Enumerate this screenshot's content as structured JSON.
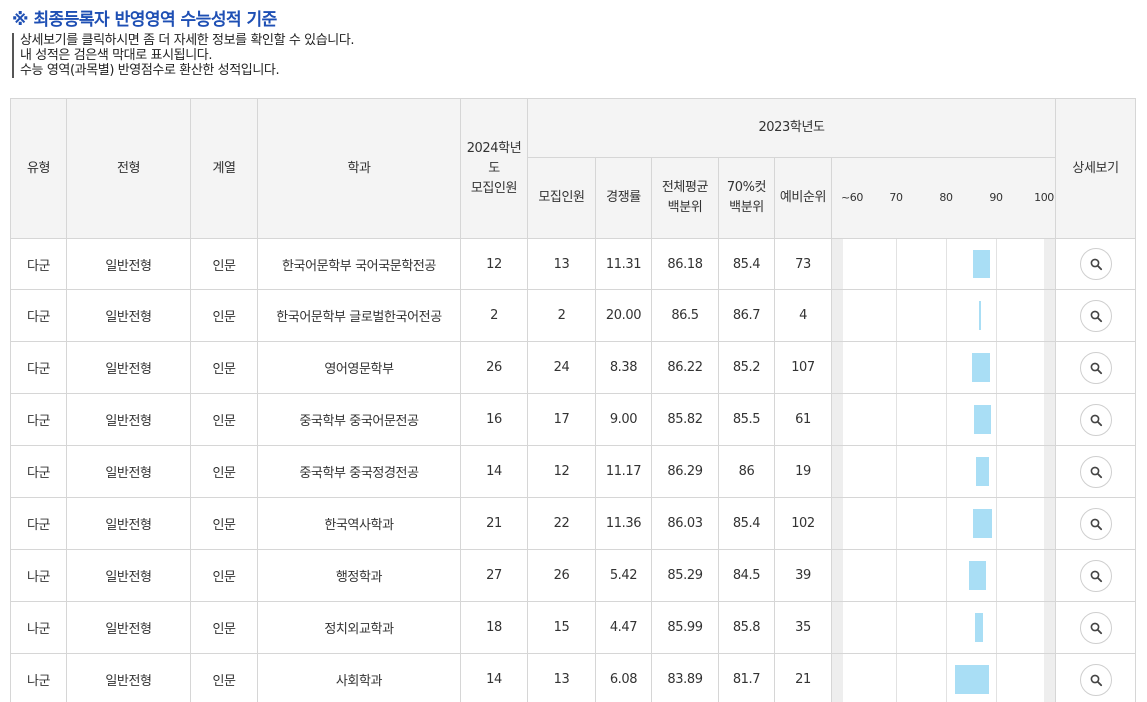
{
  "title": "※ 최종등록자 반영영역 수능성적 기준",
  "notes": [
    "상세보기를 클릭하시면 좀 더 자세한 정보를 확인할 수 있습니다.",
    "내 성적은 검은색 막대로 표시됩니다.",
    "수능 영역(과목별) 반영점수로 환산한 성적입니다."
  ],
  "headers": {
    "type": "유형",
    "admission": "전형",
    "track": "계열",
    "dept": "학과",
    "quota2024": "2024학년도\n모집인원",
    "year2023": "2023학년도",
    "quota": "모집인원",
    "ratio": "경쟁률",
    "avg": "전체평균\n백분위",
    "cut70": "70%컷\n백분위",
    "waitlist": "예비순위",
    "detail": "상세보기"
  },
  "scale_labels": [
    "~60",
    "70",
    "80",
    "90",
    "100"
  ],
  "colors": {
    "range_bar": "#a9def5",
    "title": "#1e4fb4",
    "header_bg": "#f4f4f4"
  },
  "rows": [
    {
      "type": "다군",
      "admission": "일반전형",
      "track": "인문",
      "dept": "한국어문학부 국어국문학전공",
      "quota2024": "12",
      "quota": "13",
      "ratio": "11.31",
      "avg": "86.18",
      "cut70": "85.4",
      "waitlist": "73",
      "range": [
        85.4,
        88.8
      ]
    },
    {
      "type": "다군",
      "admission": "일반전형",
      "track": "인문",
      "dept": "한국어문학부 글로벌한국어전공",
      "quota2024": "2",
      "quota": "2",
      "ratio": "20.00",
      "avg": "86.5",
      "cut70": "86.7",
      "waitlist": "4",
      "range": [
        86.5,
        86.9
      ]
    },
    {
      "type": "다군",
      "admission": "일반전형",
      "track": "인문",
      "dept": "영어영문학부",
      "quota2024": "26",
      "quota": "24",
      "ratio": "8.38",
      "avg": "86.22",
      "cut70": "85.2",
      "waitlist": "107",
      "range": [
        85.2,
        88.8
      ]
    },
    {
      "type": "다군",
      "admission": "일반전형",
      "track": "인문",
      "dept": "중국학부 중국어문전공",
      "quota2024": "16",
      "quota": "17",
      "ratio": "9.00",
      "avg": "85.82",
      "cut70": "85.5",
      "waitlist": "61",
      "range": [
        85.5,
        88.9
      ]
    },
    {
      "type": "다군",
      "admission": "일반전형",
      "track": "인문",
      "dept": "중국학부 중국정경전공",
      "quota2024": "14",
      "quota": "12",
      "ratio": "11.17",
      "avg": "86.29",
      "cut70": "86",
      "waitlist": "19",
      "range": [
        86.0,
        88.6
      ]
    },
    {
      "type": "다군",
      "admission": "일반전형",
      "track": "인문",
      "dept": "한국역사학과",
      "quota2024": "21",
      "quota": "22",
      "ratio": "11.36",
      "avg": "86.03",
      "cut70": "85.4",
      "waitlist": "102",
      "range": [
        85.4,
        89.2
      ]
    },
    {
      "type": "나군",
      "admission": "일반전형",
      "track": "인문",
      "dept": "행정학과",
      "quota2024": "27",
      "quota": "26",
      "ratio": "5.42",
      "avg": "85.29",
      "cut70": "84.5",
      "waitlist": "39",
      "range": [
        84.5,
        87.9
      ]
    },
    {
      "type": "나군",
      "admission": "일반전형",
      "track": "인문",
      "dept": "정치외교학과",
      "quota2024": "18",
      "quota": "15",
      "ratio": "4.47",
      "avg": "85.99",
      "cut70": "85.8",
      "waitlist": "35",
      "range": [
        85.8,
        87.4
      ]
    },
    {
      "type": "나군",
      "admission": "일반전형",
      "track": "인문",
      "dept": "사회학과",
      "quota2024": "14",
      "quota": "13",
      "ratio": "6.08",
      "avg": "83.89",
      "cut70": "81.7",
      "waitlist": "21",
      "range": [
        81.7,
        88.6
      ]
    }
  ]
}
